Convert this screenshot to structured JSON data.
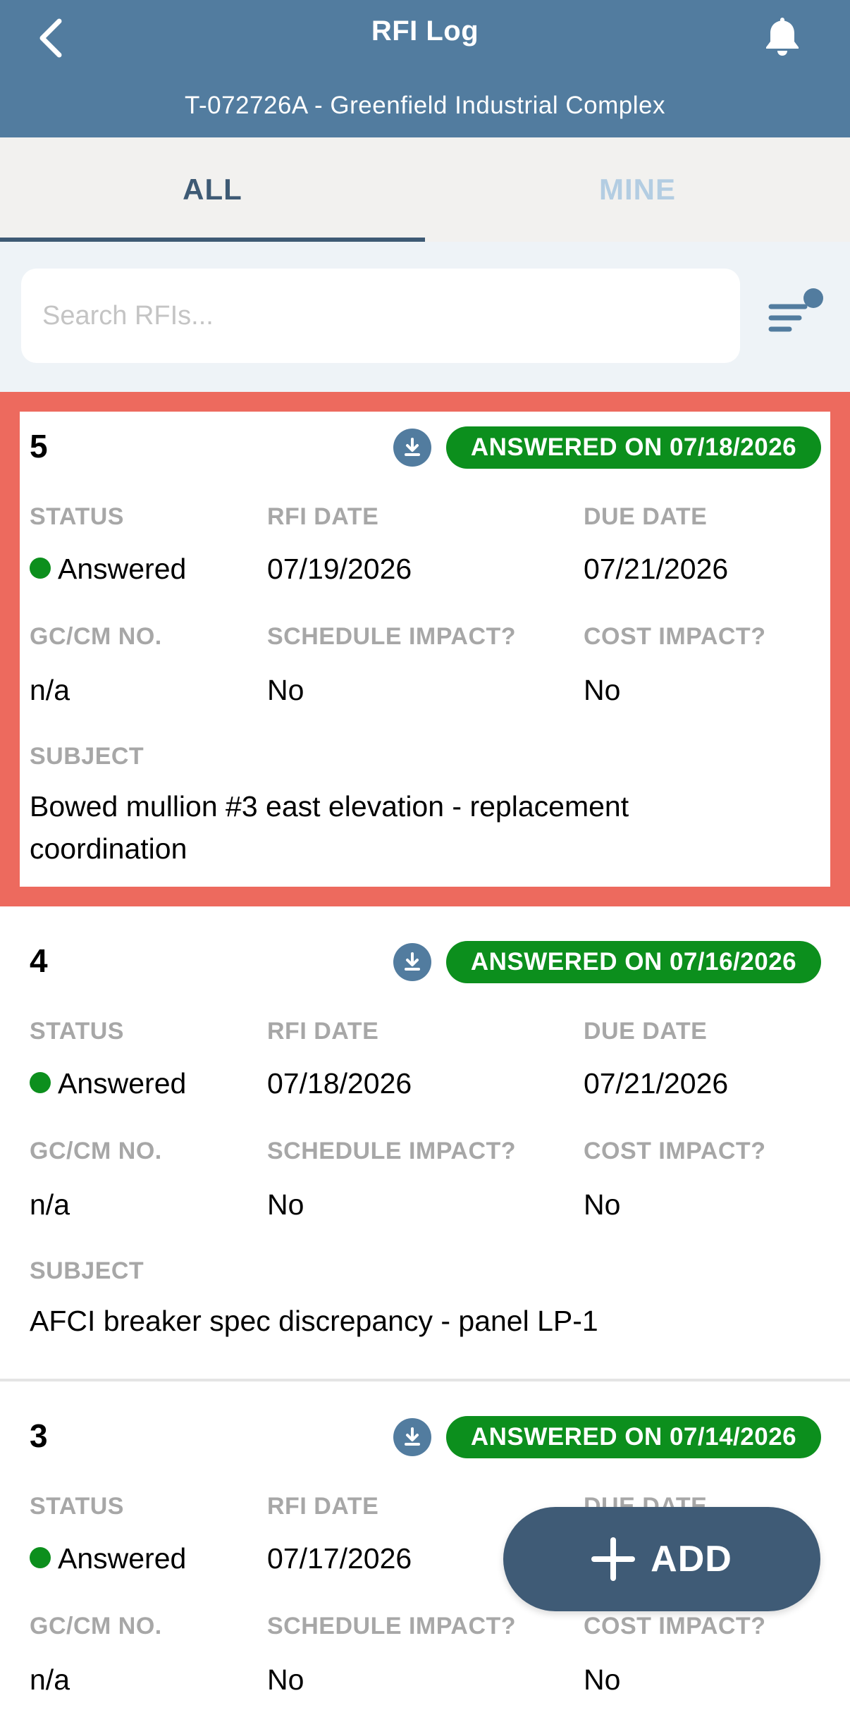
{
  "header": {
    "title": "RFI Log",
    "subtitle": "T-072726A - Greenfield Industrial Complex"
  },
  "tabs": [
    {
      "label": "ALL",
      "active": true
    },
    {
      "label": "MINE",
      "active": false
    }
  ],
  "search": {
    "placeholder": "Search RFIs...",
    "value": ""
  },
  "labels": {
    "status": "STATUS",
    "rfi_date": "RFI DATE",
    "due_date": "DUE DATE",
    "gc_cm_no": "GC/CM NO.",
    "schedule_impact": "SCHEDULE IMPACT?",
    "cost_impact": "COST IMPACT?",
    "subject": "SUBJECT"
  },
  "rfis": [
    {
      "number": "5",
      "badge": "ANSWERED ON 07/18/2026",
      "status": "Answered",
      "rfi_date": "07/19/2026",
      "due_date": "07/21/2026",
      "gc_cm_no": "n/a",
      "schedule_impact": "No",
      "cost_impact": "No",
      "subject": "Bowed mullion #3 east elevation - replacement coordination",
      "selected": true
    },
    {
      "number": "4",
      "badge": "ANSWERED ON 07/16/2026",
      "status": "Answered",
      "rfi_date": "07/18/2026",
      "due_date": "07/21/2026",
      "gc_cm_no": "n/a",
      "schedule_impact": "No",
      "cost_impact": "No",
      "subject": "AFCI breaker spec discrepancy - panel LP-1",
      "selected": false
    },
    {
      "number": "3",
      "badge": "ANSWERED ON 07/14/2026",
      "status": "Answered",
      "rfi_date": "07/17/2026",
      "due_date": "",
      "gc_cm_no": "n/a",
      "schedule_impact": "No",
      "cost_impact": "No",
      "subject": "",
      "selected": false
    }
  ],
  "fab": {
    "label": "ADD"
  },
  "colors": {
    "header_bg": "#527c9f",
    "tab_active": "#3e5a74",
    "tab_inactive": "#b3cde2",
    "badge_green": "#0c8f1d",
    "selected_border": "#ed6a5e",
    "fab_bg": "#3f5b76"
  },
  "icons": {
    "back": "chevron-left-icon",
    "bell": "bell-icon",
    "filter": "filter-icon",
    "download": "download-icon",
    "plus": "plus-icon"
  }
}
